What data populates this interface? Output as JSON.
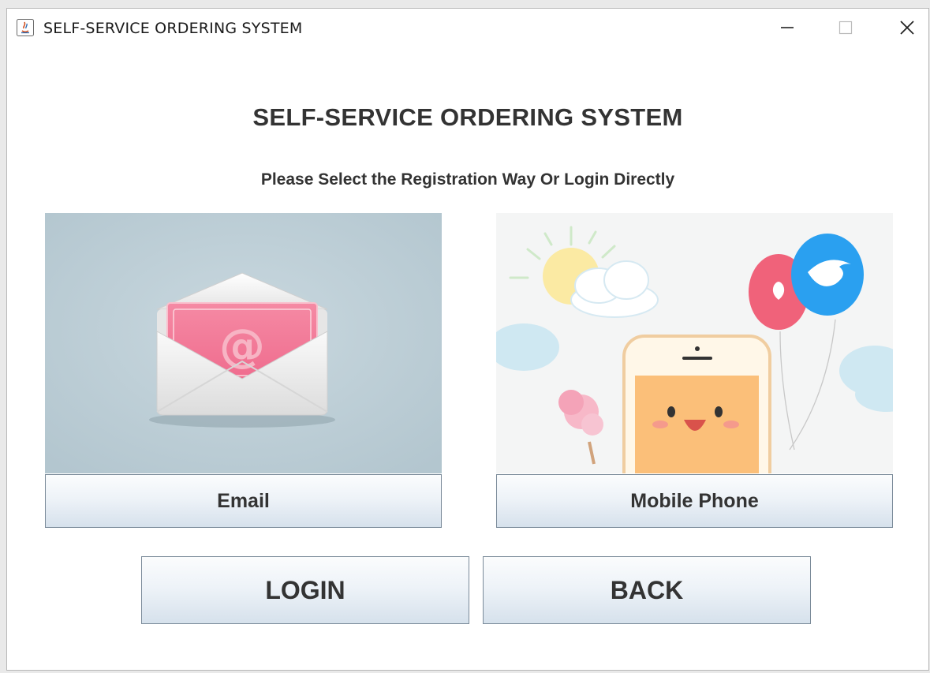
{
  "window": {
    "title": "SELF-SERVICE ORDERING SYSTEM",
    "app_icon": "java-icon",
    "controls": [
      "minimize-icon",
      "maximize-icon",
      "close-icon"
    ]
  },
  "main": {
    "heading": "SELF-SERVICE ORDERING SYSTEM",
    "subheading": "Please Select the Registration Way Or Login Directly"
  },
  "options": {
    "email": {
      "label": "Email",
      "image": "envelope-illustration"
    },
    "phone": {
      "label": "Mobile Phone",
      "image": "smartphone-balloons-illustration"
    }
  },
  "actions": {
    "login_label": "LOGIN",
    "back_label": "BACK"
  },
  "colors": {
    "button_gradient_top": "#fbfcfd",
    "button_gradient_bottom": "#d6e1ec",
    "button_border": "#7a8a99",
    "text": "#333333"
  }
}
